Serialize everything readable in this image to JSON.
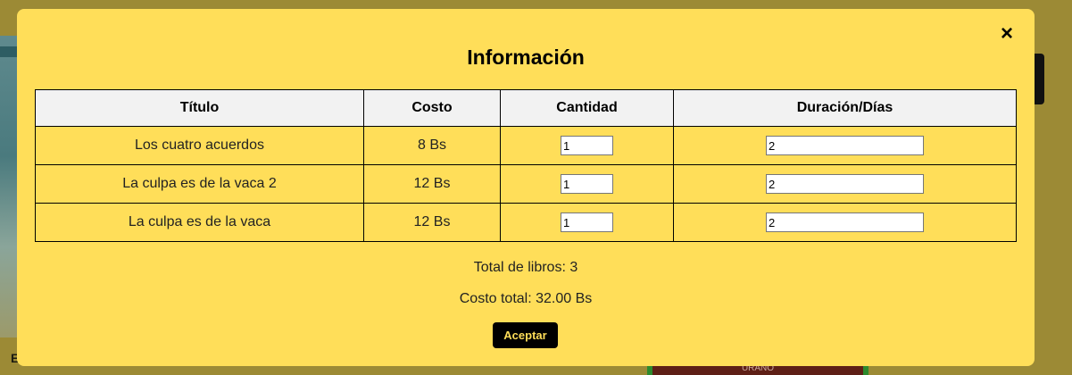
{
  "modal": {
    "title": "Información",
    "close_icon": "×",
    "table": {
      "headers": [
        "Título",
        "Costo",
        "Cantidad",
        "Duración/Días"
      ],
      "rows": [
        {
          "title": "Los cuatro acuerdos",
          "cost": "8 Bs",
          "quantity": "1",
          "duration": "2"
        },
        {
          "title": "La culpa es de la vaca 2",
          "cost": "12 Bs",
          "quantity": "1",
          "duration": "2"
        },
        {
          "title": "La culpa es de la vaca",
          "cost": "12 Bs",
          "quantity": "1",
          "duration": "2"
        }
      ]
    },
    "total_books": "Total de libros: 3",
    "total_cost": "Costo total: 32.00 Bs",
    "accept_label": "Aceptar"
  },
  "background": {
    "left_label": "E",
    "bottom_book_label": "URANO"
  },
  "colors": {
    "modal_background": "#ffde59",
    "overlay": "#9c8a35",
    "button_background": "#000000",
    "button_text": "#ffde59",
    "header_background": "#f2f2f2"
  }
}
